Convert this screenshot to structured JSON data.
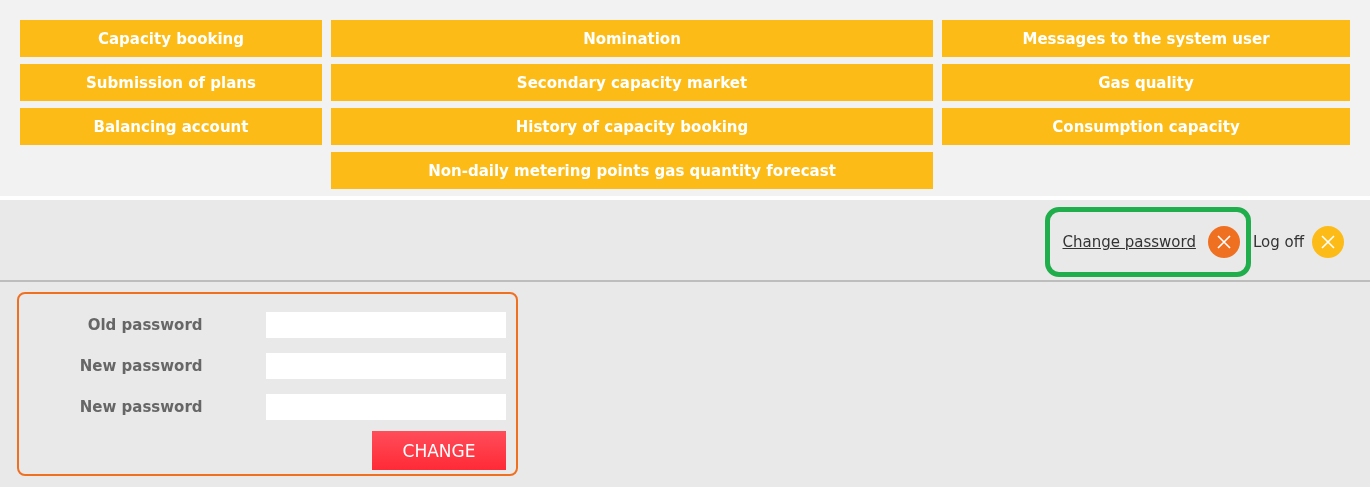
{
  "menu": {
    "columns": [
      [
        "Capacity booking",
        "Submission of plans",
        "Balancing account"
      ],
      [
        "Nomination",
        "Secondary capacity market",
        "History of capacity booking",
        "Non-daily metering points gas quantity forecast"
      ],
      [
        "Messages to the system user",
        "Gas quality",
        "Consumption capacity"
      ]
    ]
  },
  "header": {
    "change_password": "Change password",
    "log_off": "Log off"
  },
  "form": {
    "fields": [
      {
        "label": "Old password"
      },
      {
        "label": "New password"
      },
      {
        "label": "New password"
      }
    ],
    "submit": "CHANGE"
  }
}
